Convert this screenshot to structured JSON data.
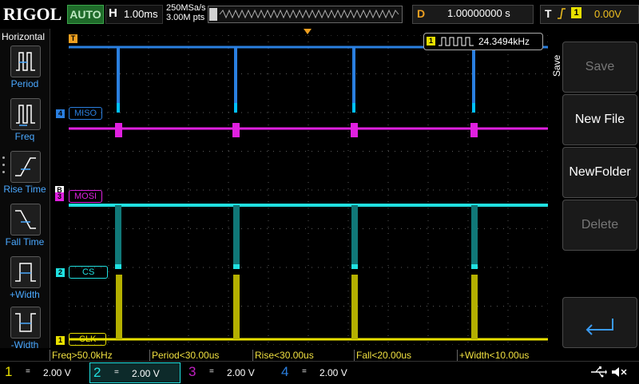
{
  "header": {
    "brand": "RIGOL",
    "run_mode": "AUTO",
    "timebase_letter": "H",
    "timebase": "1.00ms",
    "sample_rate": "250MSa/s",
    "memory_depth": "3.00M pts",
    "delay_letter": "D",
    "delay": "1.00000000 s",
    "trigger_letter": "T",
    "trigger_source": "1",
    "trigger_level": "0.00V"
  },
  "left_panel": {
    "title": "Horizontal",
    "items": [
      {
        "label": "Period"
      },
      {
        "label": "Freq"
      },
      {
        "label": "Rise Time"
      },
      {
        "label": "Fall Time"
      },
      {
        "label": "+Width"
      },
      {
        "label": "-Width"
      }
    ]
  },
  "frequency_counter": {
    "channel": "1",
    "value": "24.3494kHz"
  },
  "channels": [
    {
      "id": "4",
      "label": "MISO",
      "color": "#2a7fe0"
    },
    {
      "id": "3",
      "label": "MOSI",
      "color": "#e020e0"
    },
    {
      "id": "2",
      "label": "CS",
      "color": "#20e0e0"
    },
    {
      "id": "1",
      "label": "CLK",
      "color": "#e8e000"
    }
  ],
  "right_menu": {
    "side_label": "Save",
    "buttons": [
      {
        "label": "Save",
        "enabled": false
      },
      {
        "label": "New File",
        "enabled": true
      },
      {
        "label": "NewFolder",
        "enabled": true
      },
      {
        "label": "Delete",
        "enabled": false
      }
    ]
  },
  "measurements": [
    "Freq>50.0kHz",
    "Period<30.00us",
    "Rise<30.00us",
    "Fall<20.00us",
    "+Width<10.00us"
  ],
  "bottom_channels": [
    {
      "num": "1",
      "coupling": "=",
      "scale": "2.00 V",
      "color": "#e8e000"
    },
    {
      "num": "2",
      "coupling": "=",
      "scale": "2.00 V",
      "color": "#20e0e0"
    },
    {
      "num": "3",
      "coupling": "=",
      "scale": "2.00 V",
      "color": "#c020c0"
    },
    {
      "num": "4",
      "coupling": "=",
      "scale": "2.00 V",
      "color": "#2a7fe0"
    }
  ],
  "trace_markers": {
    "ch1_marker": "1",
    "ch2_marker": "2",
    "ch3_marker": "3",
    "ch4_marker": "4",
    "trigger_marker": "T"
  }
}
